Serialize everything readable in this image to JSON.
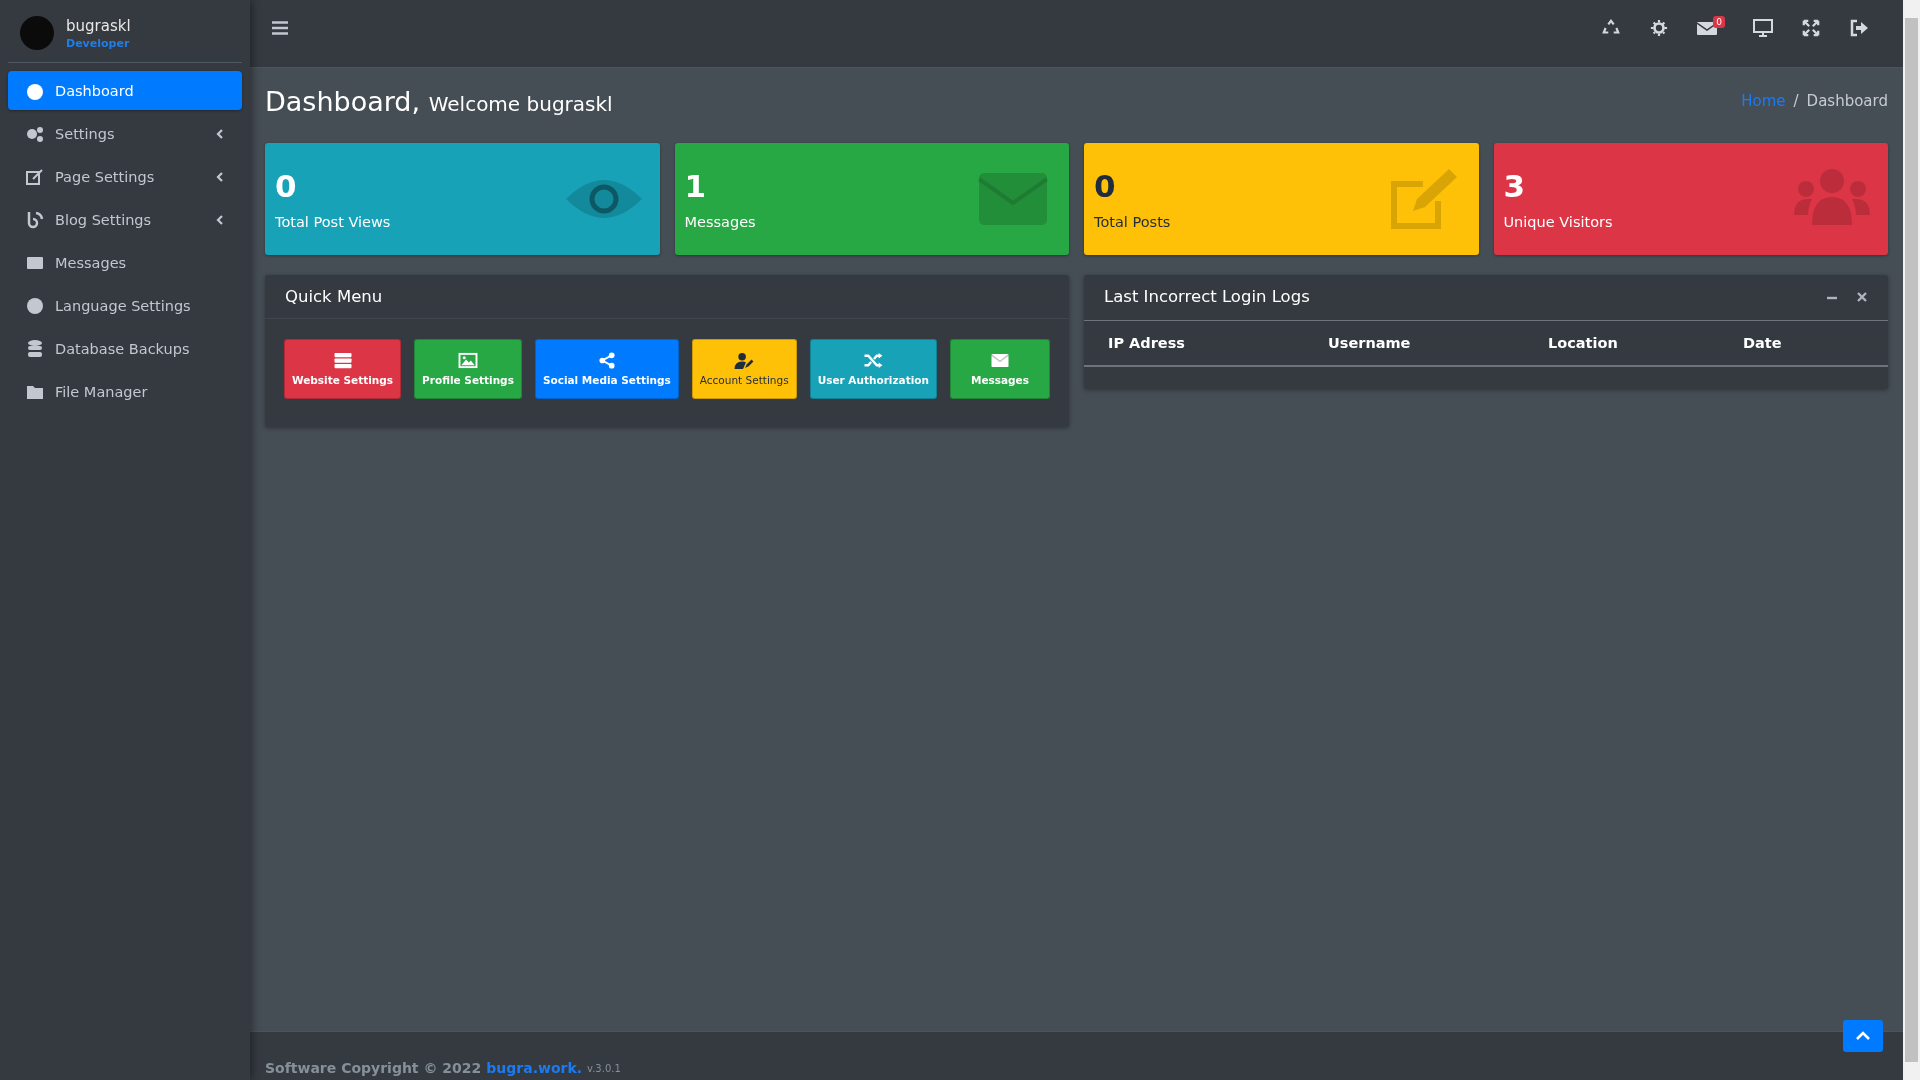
{
  "sidebar": {
    "user": {
      "name": "bugraskl",
      "role": "Developer"
    },
    "items": [
      {
        "label": "Dashboard",
        "selected": true,
        "expandable": false
      },
      {
        "label": "Settings",
        "selected": false,
        "expandable": true
      },
      {
        "label": "Page Settings",
        "selected": false,
        "expandable": true
      },
      {
        "label": "Blog Settings",
        "selected": false,
        "expandable": true
      },
      {
        "label": "Messages",
        "selected": false,
        "expandable": false
      },
      {
        "label": "Language Settings",
        "selected": false,
        "expandable": false
      },
      {
        "label": "Database Backups",
        "selected": false,
        "expandable": false
      },
      {
        "label": "File Manager",
        "selected": false,
        "expandable": false
      }
    ]
  },
  "topbar": {
    "mail_badge": "0"
  },
  "header": {
    "title": "Dashboard,",
    "subtitle": "Welcome bugraskl",
    "breadcrumb_separator": "/",
    "breadcrumb": [
      {
        "label": "Home",
        "link": true
      },
      {
        "label": "Dashboard",
        "link": false
      }
    ]
  },
  "stats": [
    {
      "value": "0",
      "label": "Total Post Views",
      "color": "#17a2b8"
    },
    {
      "value": "1",
      "label": "Messages",
      "color": "#28a745"
    },
    {
      "value": "0",
      "label": "Total Posts",
      "color": "#ffc107"
    },
    {
      "value": "3",
      "label": "Unique Visitors",
      "color": "#dc3545"
    }
  ],
  "quick_menu": {
    "title": "Quick Menu",
    "buttons": [
      {
        "label": "Website Settings",
        "color": "#dc3545"
      },
      {
        "label": "Profile Settings",
        "color": "#28a745"
      },
      {
        "label": "Social Media Settings",
        "color": "#007bff"
      },
      {
        "label": "Account Settings",
        "color": "#ffc107"
      },
      {
        "label": "User Authorization",
        "color": "#17a2b8"
      },
      {
        "label": "Messages",
        "color": "#28a745"
      }
    ]
  },
  "login_logs": {
    "title": "Last Incorrect Login Logs",
    "columns": [
      "IP Adress",
      "Username",
      "Location",
      "Date"
    ]
  },
  "footer": {
    "text": "Software Copyright © 2022",
    "link": "bugra.work.",
    "version": "v.3.0.1"
  }
}
